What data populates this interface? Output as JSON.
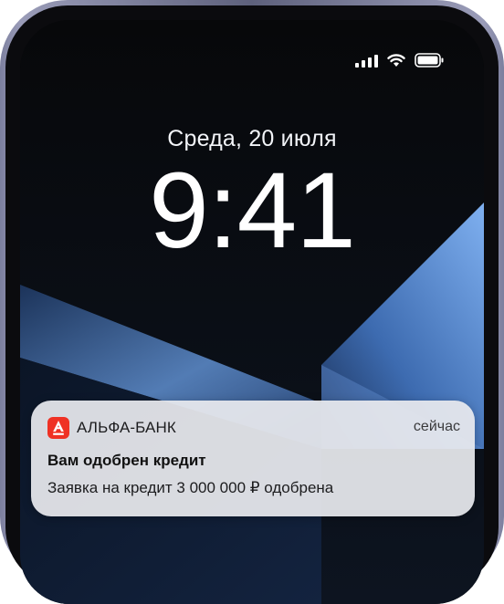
{
  "status_bar": {
    "signal_icon": "cellular-signal-icon",
    "wifi_icon": "wifi-icon",
    "battery_icon": "battery-icon"
  },
  "lock_screen": {
    "date": "Среда, 20 июля",
    "time": "9:41"
  },
  "notification": {
    "app_icon": "alfa-bank-logo-icon",
    "app_icon_color": "#ef3124",
    "app_name": "АЛЬФА-БАНК",
    "time": "сейчас",
    "title": "Вам одобрен кредит",
    "body": "Заявка на кредит 3 000 000 ₽ одобрена"
  }
}
